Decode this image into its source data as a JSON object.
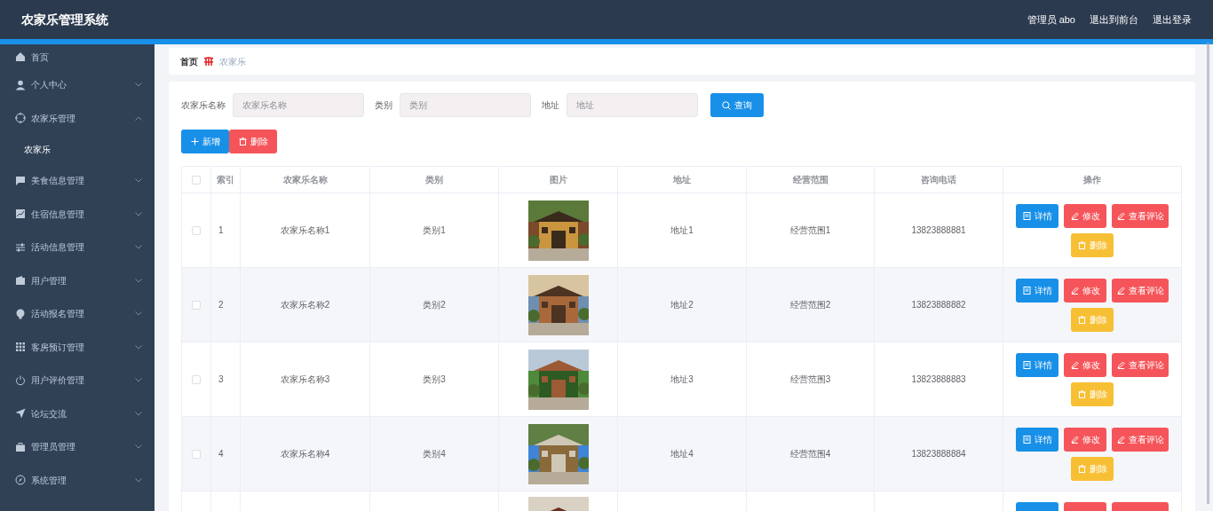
{
  "header": {
    "title": "农家乐管理系统",
    "links": [
      "管理员 abo",
      "退出到前台",
      "退出登录"
    ]
  },
  "sidebar": {
    "items": [
      {
        "label": "首页"
      },
      {
        "label": "个人中心",
        "expanded": false
      },
      {
        "label": "农家乐管理",
        "expanded": true,
        "children": [
          {
            "label": "农家乐"
          }
        ]
      },
      {
        "label": "美食信息管理",
        "expanded": false
      },
      {
        "label": "住宿信息管理",
        "expanded": false
      },
      {
        "label": "活动信息管理",
        "expanded": false
      },
      {
        "label": "用户管理",
        "expanded": false
      },
      {
        "label": "活动报名管理",
        "expanded": false
      },
      {
        "label": "客房预订管理",
        "expanded": false
      },
      {
        "label": "用户评价管理",
        "expanded": false
      },
      {
        "label": "论坛交流",
        "expanded": false
      },
      {
        "label": "管理员管理",
        "expanded": false
      },
      {
        "label": "系统管理",
        "expanded": false
      }
    ]
  },
  "breadcrumb": [
    "首页",
    "农家乐"
  ],
  "search": {
    "fields": [
      {
        "label": "农家乐名称",
        "placeholder": "农家乐名称"
      },
      {
        "label": "类别",
        "placeholder": "类别"
      },
      {
        "label": "地址",
        "placeholder": "地址"
      }
    ],
    "button": "查询"
  },
  "toolbar": [
    {
      "label": "新增",
      "kind": "add"
    },
    {
      "label": "删除",
      "kind": "delete"
    }
  ],
  "table": {
    "columns": [
      "索引",
      "农家乐名称",
      "类别",
      "图片",
      "地址",
      "经营范围",
      "咨询电话",
      "操作"
    ],
    "header_checked": false,
    "rows": [
      {
        "checked": false,
        "cells": [
          "1",
          "农家乐名称1",
          "类别1",
          "地址1",
          "经营范围1",
          "13823888881"
        ],
        "actions": [
          {
            "label": "详情",
            "kind": "detail"
          },
          {
            "label": "修改",
            "kind": "edit"
          },
          {
            "label": "查看评论",
            "kind": "comment"
          },
          {
            "label": "删除",
            "kind": "remove"
          }
        ]
      },
      {
        "checked": false,
        "cells": [
          "2",
          "农家乐名称2",
          "类别2",
          "地址2",
          "经营范围2",
          "13823888882"
        ],
        "actions": [
          {
            "label": "详情",
            "kind": "detail"
          },
          {
            "label": "修改",
            "kind": "edit"
          },
          {
            "label": "查看评论",
            "kind": "comment"
          },
          {
            "label": "删除",
            "kind": "remove"
          }
        ]
      },
      {
        "checked": false,
        "cells": [
          "3",
          "农家乐名称3",
          "类别3",
          "地址3",
          "经营范围3",
          "13823888883"
        ],
        "actions": [
          {
            "label": "详情",
            "kind": "detail"
          },
          {
            "label": "修改",
            "kind": "edit"
          },
          {
            "label": "查看评论",
            "kind": "comment"
          },
          {
            "label": "删除",
            "kind": "remove"
          }
        ]
      },
      {
        "checked": false,
        "cells": [
          "4",
          "农家乐名称4",
          "类别4",
          "地址4",
          "经营范围4",
          "13823888884"
        ],
        "actions": [
          {
            "label": "详情",
            "kind": "detail"
          },
          {
            "label": "修改",
            "kind": "edit"
          },
          {
            "label": "查看评论",
            "kind": "comment"
          },
          {
            "label": "删除",
            "kind": "remove"
          }
        ]
      },
      {
        "actions": [
          {
            "kind": "detail"
          },
          {
            "kind": "edit"
          },
          {
            "kind": "comment"
          }
        ]
      }
    ]
  }
}
